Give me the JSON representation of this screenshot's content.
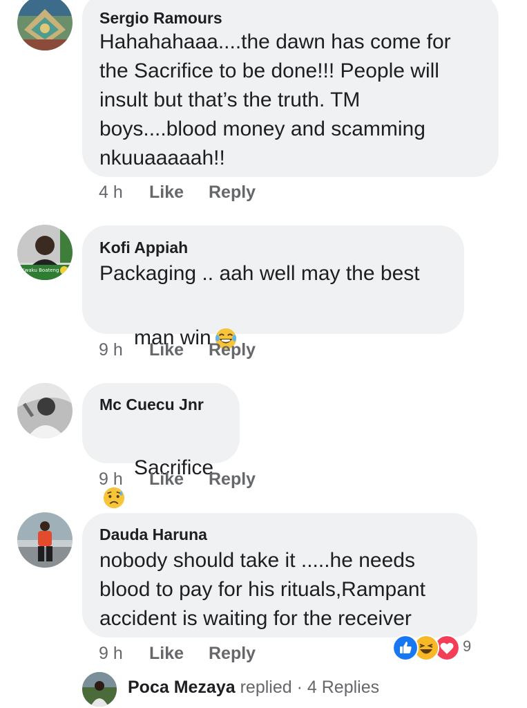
{
  "comments": [
    {
      "author": "Sergio Ramours",
      "text": "Hahahahaaa....the dawn has come for\nthe Sacrifice to be done!!! People will\ninsult but that’s the truth. TM\nboys....blood money and scamming\nnkuuaaaaah!!",
      "time": "4 h",
      "like": "Like",
      "reply": "Reply"
    },
    {
      "author": "Kofi Appiah",
      "text_line1": "Packaging .. aah well may the best",
      "text_line2": "man win",
      "emoji": "laughing-tears-emoji",
      "avatar_caption": "Kwaku Boateng",
      "time": "9 h",
      "like": "Like",
      "reply": "Reply"
    },
    {
      "author": "Mc Cuecu Jnr",
      "text": "Sacrifice",
      "emoji": "sad-sweat-emoji",
      "time": "9 h",
      "like": "Like",
      "reply": "Reply"
    },
    {
      "author": "Dauda Haruna",
      "text": "nobody should take it .....he needs\nblood to pay for his rituals,Rampant\naccident is waiting for the receiver",
      "time": "9 h",
      "like": "Like",
      "reply": "Reply",
      "reactions": {
        "icons": [
          "like-reaction-icon",
          "haha-reaction-icon",
          "love-reaction-icon"
        ],
        "count": "9",
        "colors": {
          "like": "#1877f2",
          "haha": "#f7b928",
          "love": "#f33e58"
        }
      }
    }
  ],
  "replies_summary": {
    "name": "Poca Mezaya",
    "replied": "replied",
    "separator": "·",
    "count_text": "4 Replies"
  }
}
